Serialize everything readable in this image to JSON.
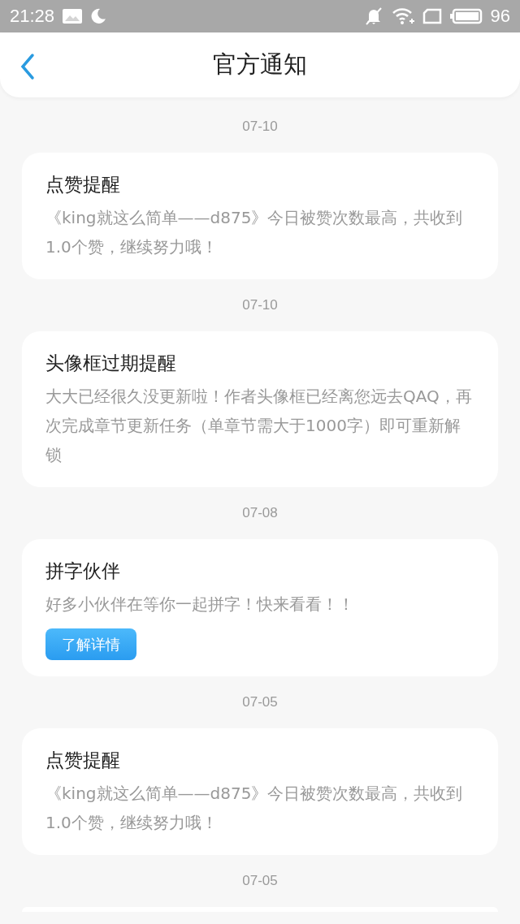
{
  "status_bar": {
    "time": "21:28",
    "battery": "96"
  },
  "header": {
    "title": "官方通知"
  },
  "notices": [
    {
      "date": "07-10",
      "title": "点赞提醒",
      "body": "《king就这么简单——d875》今日被赞次数最高，共收到1.0个赞，继续努力哦！"
    },
    {
      "date": "07-10",
      "title": "头像框过期提醒",
      "body": "大大已经很久没更新啦！作者头像框已经离您远去QAQ，再次完成章节更新任务（单章节需大于1000字）即可重新解锁"
    },
    {
      "date": "07-08",
      "title": "拼字伙伴",
      "body": "好多小伙伴在等你一起拼字！快来看看！！",
      "button": "了解详情"
    },
    {
      "date": "07-05",
      "title": "点赞提醒",
      "body": "《king就这么简单——d875》今日被赞次数最高，共收到1.0个赞，继续努力哦！"
    },
    {
      "date": "07-05"
    }
  ]
}
